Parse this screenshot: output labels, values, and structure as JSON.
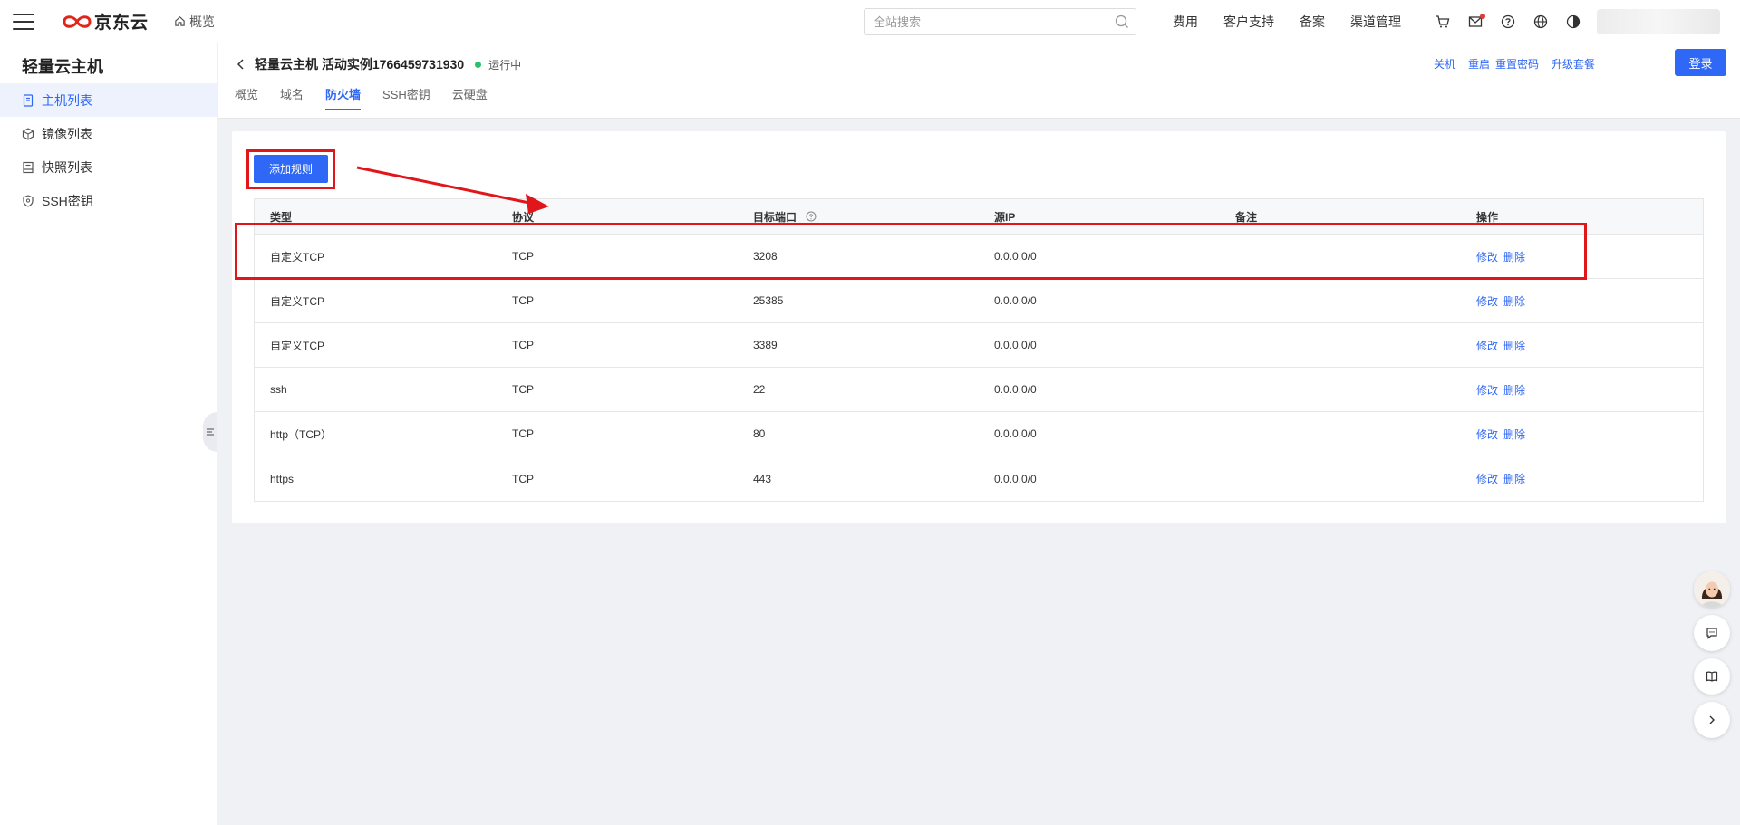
{
  "topbar": {
    "logo_text": "京东云",
    "overview_label": "概览",
    "search_placeholder": "全站搜索",
    "nav": [
      "费用",
      "客户支持",
      "备案",
      "渠道管理"
    ],
    "icons": [
      "cart-icon",
      "mail-icon",
      "help-icon",
      "globe-icon",
      "theme-icon"
    ]
  },
  "sidebar": {
    "title": "轻量云主机",
    "items": [
      {
        "label": "主机列表",
        "icon": "host-list-icon",
        "active": true
      },
      {
        "label": "镜像列表",
        "icon": "image-list-icon",
        "active": false
      },
      {
        "label": "快照列表",
        "icon": "snapshot-list-icon",
        "active": false
      },
      {
        "label": "SSH密钥",
        "icon": "ssh-key-icon",
        "active": false
      }
    ]
  },
  "header": {
    "instance_title": "轻量云主机 活动实例1766459731930",
    "status": "运行中",
    "actions": [
      "关机",
      "重启",
      "重置密码",
      "升级套餐"
    ],
    "login_label": "登录",
    "tabs": [
      {
        "label": "概览",
        "active": false
      },
      {
        "label": "域名",
        "active": false
      },
      {
        "label": "防火墙",
        "active": true
      },
      {
        "label": "SSH密钥",
        "active": false
      },
      {
        "label": "云硬盘",
        "active": false
      }
    ]
  },
  "firewall": {
    "add_rule_label": "添加规则",
    "columns": [
      "类型",
      "协议",
      "目标端口",
      "源IP",
      "备注",
      "操作"
    ],
    "edit_label": "修改",
    "delete_label": "删除",
    "rows": [
      {
        "type": "自定义TCP",
        "protocol": "TCP",
        "port": "3208",
        "source": "0.0.0.0/0",
        "note": ""
      },
      {
        "type": "自定义TCP",
        "protocol": "TCP",
        "port": "25385",
        "source": "0.0.0.0/0",
        "note": ""
      },
      {
        "type": "自定义TCP",
        "protocol": "TCP",
        "port": "3389",
        "source": "0.0.0.0/0",
        "note": ""
      },
      {
        "type": "ssh",
        "protocol": "TCP",
        "port": "22",
        "source": "0.0.0.0/0",
        "note": ""
      },
      {
        "type": "http（TCP）",
        "protocol": "TCP",
        "port": "80",
        "source": "0.0.0.0/0",
        "note": ""
      },
      {
        "type": "https",
        "protocol": "TCP",
        "port": "443",
        "source": "0.0.0.0/0",
        "note": ""
      }
    ]
  },
  "colors": {
    "accent": "#2f67f6",
    "highlight": "#e0161b",
    "status": "#27c26b",
    "logo_red": "#e1251b"
  }
}
